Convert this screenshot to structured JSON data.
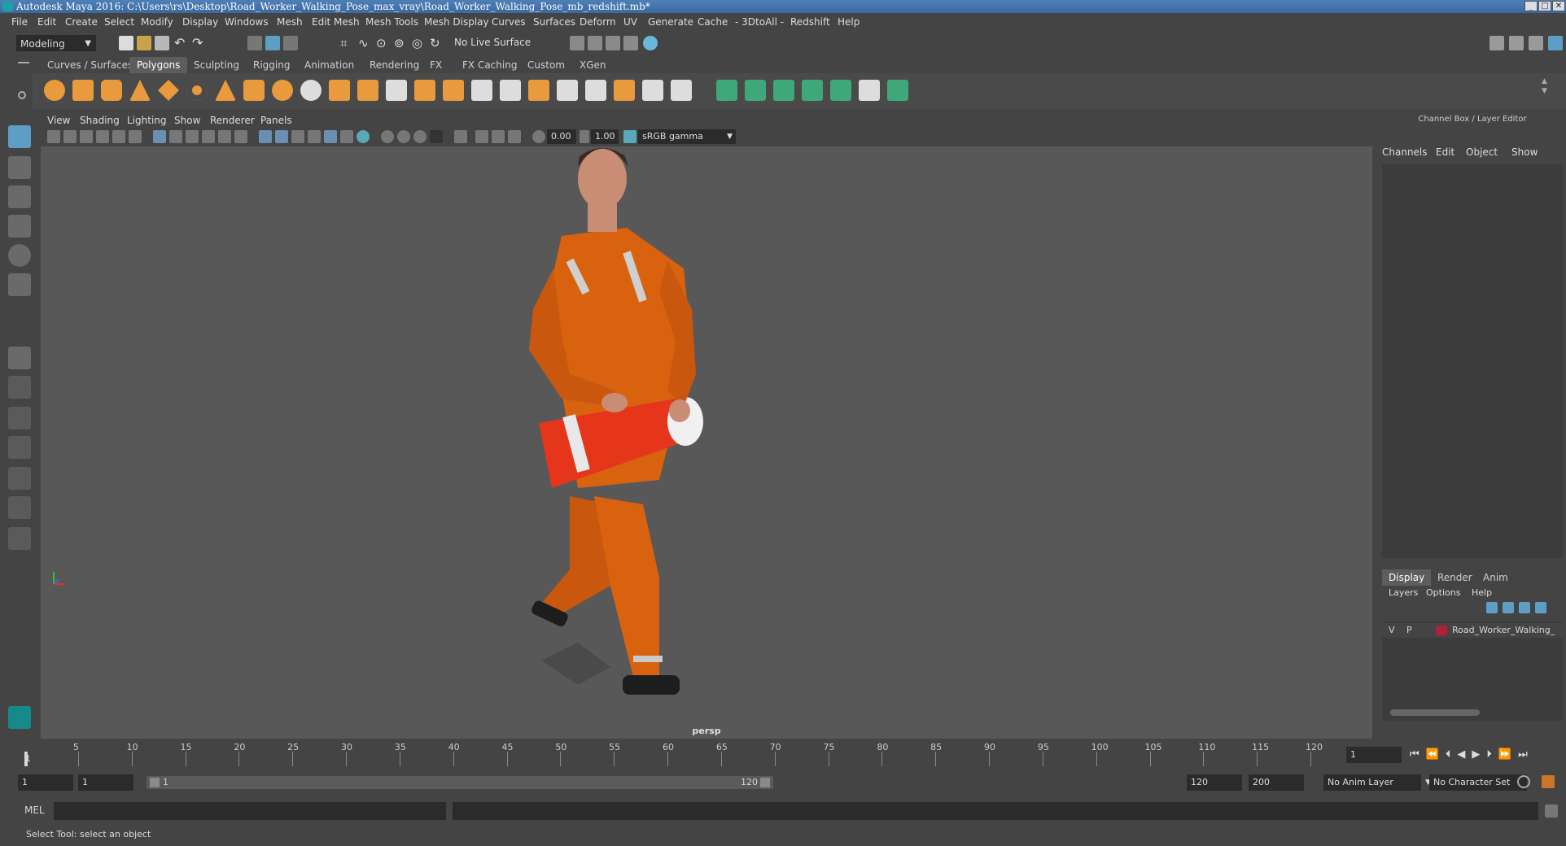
{
  "window": {
    "title": "Autodesk Maya 2016: C:\\Users\\rs\\Desktop\\Road_Worker_Walking_Pose_max_vray\\Road_Worker_Walking_Pose_mb_redshift.mb*",
    "buttons": [
      "minimize",
      "maximize",
      "close"
    ]
  },
  "menu": [
    "File",
    "Edit",
    "Create",
    "Select",
    "Modify",
    "Display",
    "Windows",
    "Mesh",
    "Edit Mesh",
    "Mesh Tools",
    "Mesh Display",
    "Curves",
    "Surfaces",
    "Deform",
    "UV",
    "Generate",
    "Cache",
    "- 3DtoAll -",
    "Redshift",
    "Help"
  ],
  "status": {
    "mode": "Modeling",
    "live_surface": "No Live Surface"
  },
  "shelf": {
    "tabs": [
      "Curves / Surfaces",
      "Polygons",
      "Sculpting",
      "Rigging",
      "Animation",
      "Rendering",
      "FX",
      "FX Caching",
      "Custom",
      "XGen"
    ],
    "active_tab": "Polygons"
  },
  "viewport": {
    "menu": [
      "View",
      "Shading",
      "Lighting",
      "Show",
      "Renderer",
      "Panels"
    ],
    "exposure": "0.00",
    "gamma": "1.00",
    "color_space": "sRGB gamma",
    "camera": "persp"
  },
  "channel_box": {
    "title": "Channel Box / Layer Editor",
    "menu": [
      "Channels",
      "Edit",
      "Object",
      "Show"
    ],
    "layer_tabs": [
      "Display",
      "Render",
      "Anim"
    ],
    "active_layer_tab": "Display",
    "layer_menu": [
      "Layers",
      "Options",
      "Help"
    ],
    "layer": {
      "v": "V",
      "p": "P",
      "name": "Road_Worker_Walking_",
      "color": "#b0203a"
    }
  },
  "timeline": {
    "ticks": [
      "5",
      "10",
      "15",
      "20",
      "25",
      "30",
      "35",
      "40",
      "45",
      "50",
      "55",
      "60",
      "65",
      "70",
      "75",
      "80",
      "85",
      "90",
      "95",
      "100",
      "105",
      "110",
      "115",
      "120"
    ],
    "start_label": "1",
    "current_frame": "1"
  },
  "range": {
    "start": "1",
    "inner_start": "1",
    "slider_start": "1",
    "slider_end": "120",
    "end": "120",
    "max": "200",
    "anim_layer": "No Anim Layer",
    "character_set": "No Character Set"
  },
  "command": {
    "lang": "MEL"
  },
  "help_line": "Select Tool: select an object",
  "colors": {
    "accent": "#5d9ec4",
    "suit_orange": "#d9620f",
    "shelf_orange": "#e89a3c",
    "shelf_green": "#3ea87a"
  }
}
